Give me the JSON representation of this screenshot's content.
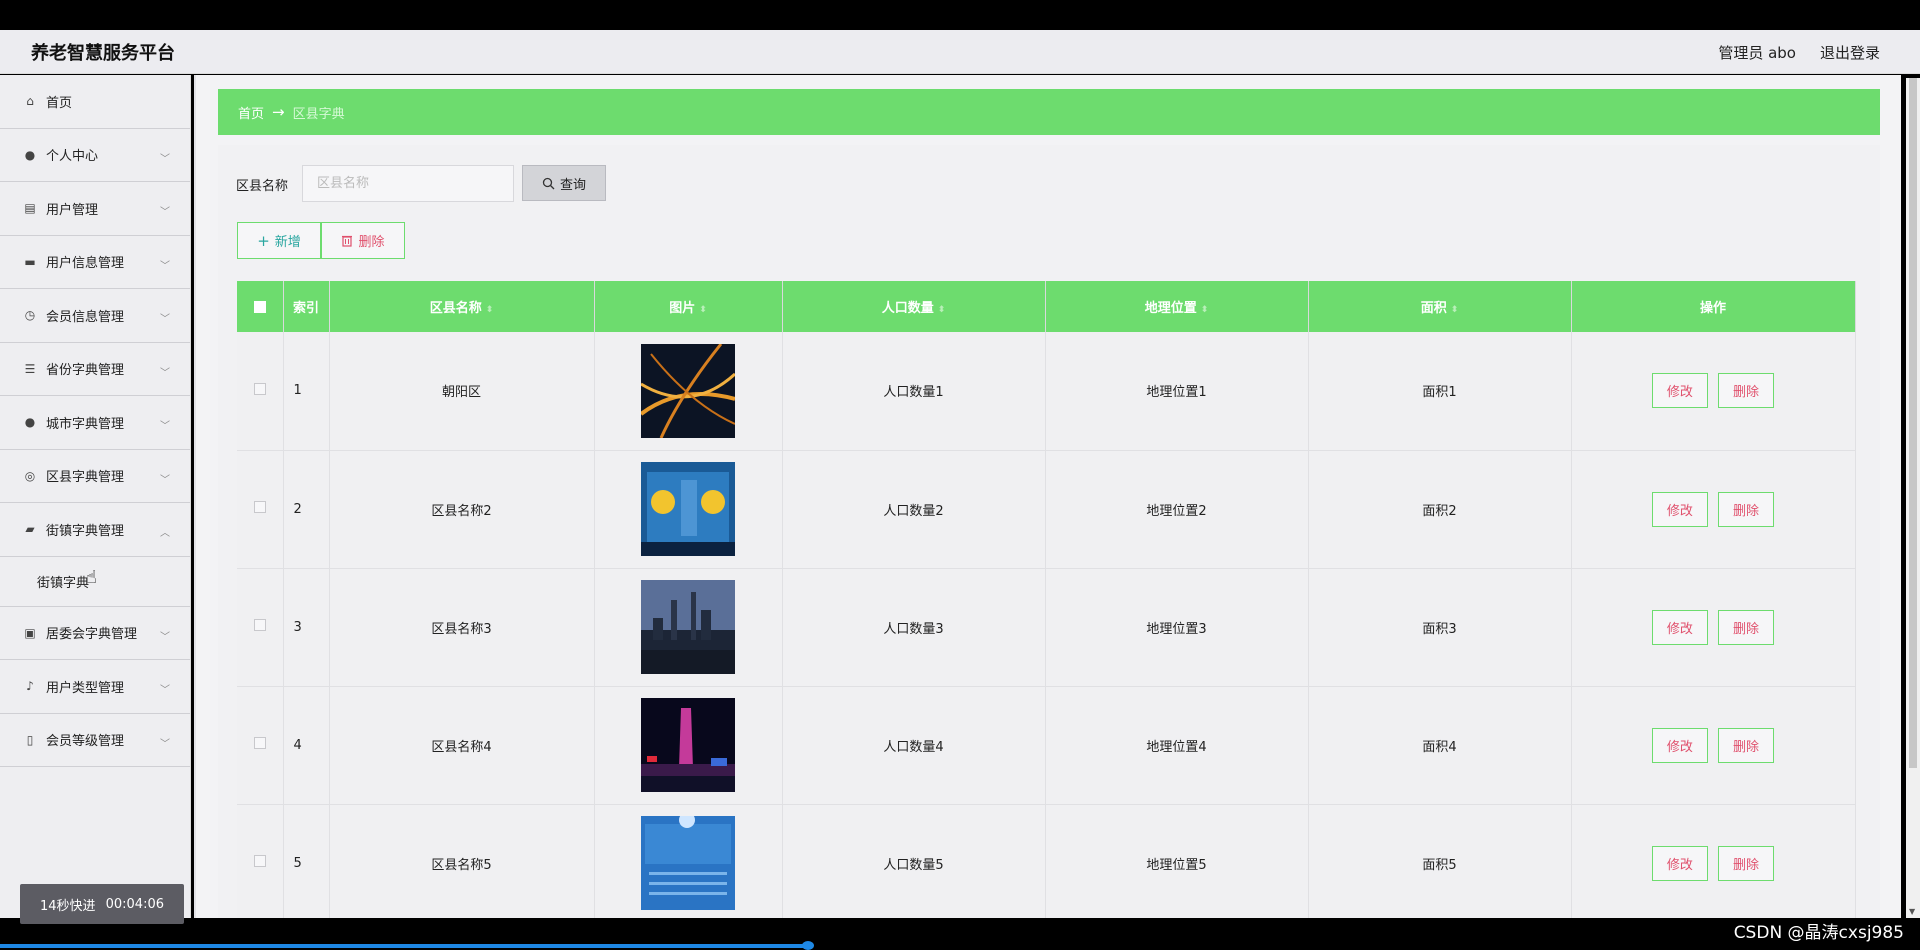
{
  "header": {
    "app_title": "养老智慧服务平台",
    "user": "管理员 abo",
    "logout": "退出登录"
  },
  "sidebar": {
    "items": [
      {
        "label": "首页",
        "icon": "home-icon",
        "glyph": "⌂",
        "expand": false
      },
      {
        "label": "个人中心",
        "icon": "person-icon",
        "glyph": "●",
        "expand": true
      },
      {
        "label": "用户管理",
        "icon": "chart-icon",
        "glyph": "▤",
        "expand": true
      },
      {
        "label": "用户信息管理",
        "icon": "monitor-icon",
        "glyph": "▬",
        "expand": true
      },
      {
        "label": "会员信息管理",
        "icon": "clock-icon",
        "glyph": "◷",
        "expand": true
      },
      {
        "label": "省份字典管理",
        "icon": "list-icon",
        "glyph": "☰",
        "expand": true
      },
      {
        "label": "城市字典管理",
        "icon": "person-icon",
        "glyph": "●",
        "expand": true
      },
      {
        "label": "区县字典管理",
        "icon": "compass-icon",
        "glyph": "◎",
        "expand": true
      },
      {
        "label": "街镇字典管理",
        "icon": "ticket-icon",
        "glyph": "▰",
        "expand": true,
        "open": true
      }
    ],
    "sub_item": "街镇字典",
    "items_after": [
      {
        "label": "居委会字典管理",
        "icon": "briefcase-icon",
        "glyph": "▣",
        "expand": true
      },
      {
        "label": "用户类型管理",
        "icon": "mic-icon",
        "glyph": "♪",
        "expand": true
      },
      {
        "label": "会员等级管理",
        "icon": "phone-icon",
        "glyph": "▯",
        "expand": true
      }
    ]
  },
  "breadcrumb": {
    "home": "首页",
    "arrow": "→",
    "current": "区县字典"
  },
  "search": {
    "label": "区县名称",
    "placeholder": "区县名称",
    "button": "查询"
  },
  "actions": {
    "add": "新增",
    "delete": "删除"
  },
  "table": {
    "columns": [
      "索引",
      "区县名称",
      "图片",
      "人口数量",
      "地理位置",
      "面积",
      "操作"
    ],
    "edit_label": "修改",
    "delete_label": "删除",
    "rows": [
      {
        "index": "1",
        "name": "朝阳区",
        "population": "人口数量1",
        "location": "地理位置1",
        "area": "面积1",
        "image": "night-overpass"
      },
      {
        "index": "2",
        "name": "区县名称2",
        "population": "人口数量2",
        "location": "地理位置2",
        "area": "面积2",
        "image": "weather-widget"
      },
      {
        "index": "3",
        "name": "区县名称3",
        "population": "人口数量3",
        "location": "地理位置3",
        "area": "面积3",
        "image": "city-skyline-dusk"
      },
      {
        "index": "4",
        "name": "区县名称4",
        "population": "人口数量4",
        "location": "地理位置4",
        "area": "面积4",
        "image": "tower-at-night"
      },
      {
        "index": "5",
        "name": "区县名称5",
        "population": "人口数量5",
        "location": "地理位置5",
        "area": "面积5",
        "image": "weather-forecast"
      }
    ]
  },
  "video": {
    "skip": "14秒快进",
    "time": "00:04:06"
  },
  "watermark": "CSDN @晶涛cxsj985",
  "colors": {
    "accent": "#6ddc6e",
    "danger": "#e0506c",
    "teal": "#2aa6a0"
  }
}
